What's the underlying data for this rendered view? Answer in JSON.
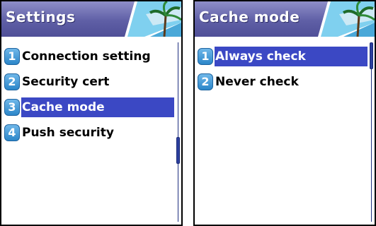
{
  "screens": [
    {
      "title": "Settings",
      "selected_index": 2,
      "items": [
        {
          "number": "1",
          "label": "Connection setting"
        },
        {
          "number": "2",
          "label": "Security cert"
        },
        {
          "number": "3",
          "label": "Cache mode"
        },
        {
          "number": "4",
          "label": "Push security"
        }
      ],
      "scroll_position_fraction": 0.62
    },
    {
      "title": "Cache mode",
      "selected_index": 0,
      "items": [
        {
          "number": "1",
          "label": "Always check"
        },
        {
          "number": "2",
          "label": "Never check"
        }
      ],
      "scroll_position_fraction": 0.0
    }
  ],
  "icons": {
    "number_badge": "number-badge-icon",
    "title_art": "palm-tree-beach-icon"
  },
  "colors": {
    "title_bar": "#5f5fa6",
    "selection": "#3b48c4",
    "badge": "#2b86c9",
    "scrollbar": "#2b3f9e"
  }
}
